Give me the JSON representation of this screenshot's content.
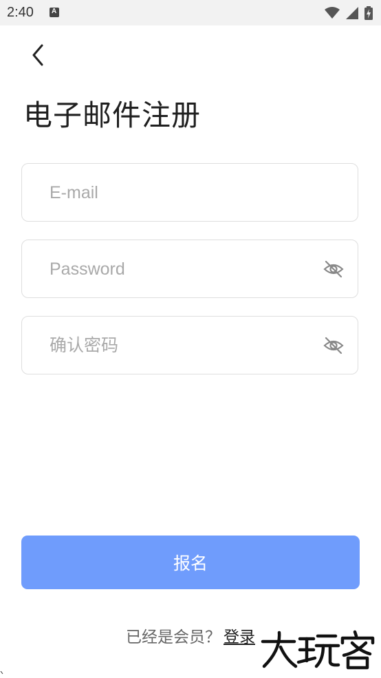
{
  "status_bar": {
    "time": "2:40",
    "icons": [
      "a-notification-icon",
      "wifi-icon",
      "signal-icon",
      "battery-icon"
    ]
  },
  "header": {
    "back_icon": "chevron-left-icon",
    "title": "电子邮件注册"
  },
  "form": {
    "email": {
      "placeholder": "E-mail",
      "value": ""
    },
    "password": {
      "placeholder": "Password",
      "value": "",
      "toggle_icon": "eye-off-icon"
    },
    "confirm_password": {
      "placeholder": "确认密码",
      "value": "",
      "toggle_icon": "eye-off-icon"
    }
  },
  "submit": {
    "label": "报名"
  },
  "footer": {
    "prompt": "已经是会员？",
    "login_label": "登录"
  },
  "watermark": {
    "text": "大玩客"
  },
  "colors": {
    "primary": "#6f9cfc",
    "border": "#dedede",
    "placeholder": "#a9a9a9",
    "status_bar_bg": "#f2f2f2"
  }
}
